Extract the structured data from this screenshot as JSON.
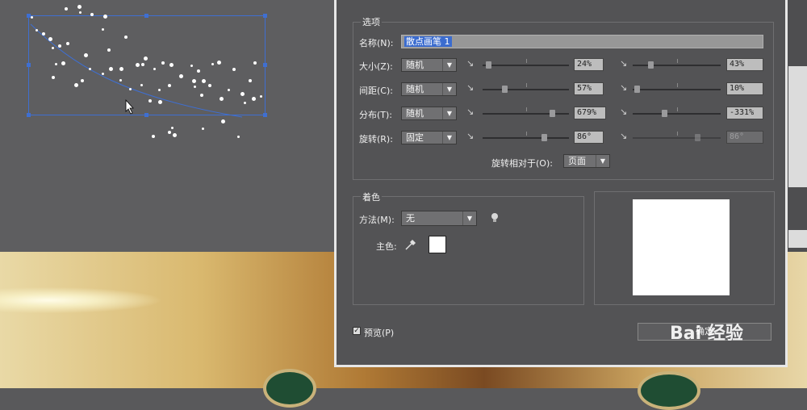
{
  "dialog": {
    "options_title": "选项",
    "name_label": "名称(N):",
    "name_value": "散点画笔 1",
    "rows": [
      {
        "label": "大小(Z):",
        "mode": "随机",
        "min": "24%",
        "max": "43%"
      },
      {
        "label": "间距(C):",
        "mode": "随机",
        "min": "57%",
        "max": "10%"
      },
      {
        "label": "分布(T):",
        "mode": "随机",
        "min": "679%",
        "max": "-331%"
      },
      {
        "label": "旋转(R):",
        "mode": "固定",
        "min": "86°",
        "max": "86°"
      }
    ],
    "rotation_relative_label": "旋转相对于(O):",
    "rotation_relative_value": "页面",
    "colorization_title": "着色",
    "method_label": "方法(M):",
    "method_value": "无",
    "key_color_label": "主色:",
    "preview_label": "预览(P)",
    "preview_checked": true,
    "ok_label": "确定",
    "watermark": "Bai 经验",
    "colors": {
      "accent": "#3b6ccf",
      "dialog_bg": "#535355",
      "selection": "#3f6fd1"
    }
  },
  "icons": [
    "cursor-arrow-icon",
    "pressure-pen-icon",
    "eyedropper-icon",
    "tip-bulb-icon",
    "dropdown-arrow-icon",
    "checkmark-icon"
  ]
}
